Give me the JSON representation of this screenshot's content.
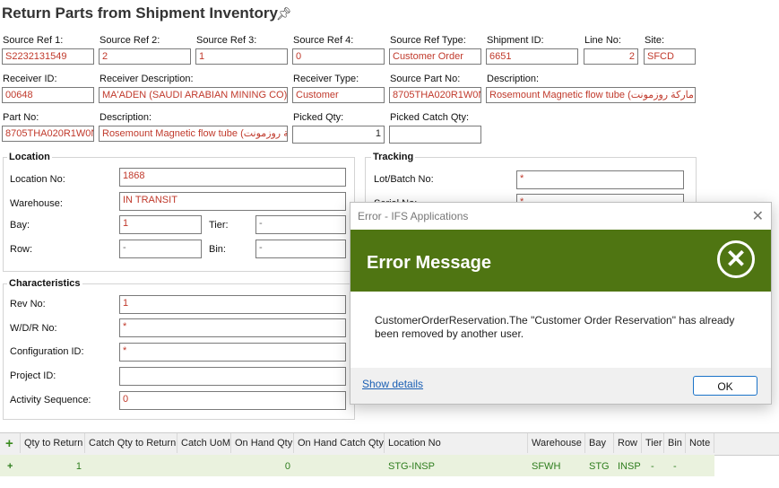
{
  "page": {
    "title": "Return Parts from Shipment Inventory"
  },
  "header_fields": {
    "source_ref1": {
      "label": "Source Ref 1:",
      "value": "S2232131549"
    },
    "source_ref2": {
      "label": "Source Ref 2:",
      "value": "2"
    },
    "source_ref3": {
      "label": "Source Ref 3:",
      "value": "1"
    },
    "source_ref4": {
      "label": "Source Ref 4:",
      "value": "0"
    },
    "source_ref_type": {
      "label": "Source Ref Type:",
      "value": "Customer Order"
    },
    "shipment_id": {
      "label": "Shipment ID:",
      "value": "6651"
    },
    "line_no": {
      "label": "Line No:",
      "value": "2"
    },
    "site": {
      "label": "Site:",
      "value": "SFCD"
    },
    "receiver_id": {
      "label": "Receiver ID:",
      "value": "00648"
    },
    "receiver_desc": {
      "label": "Receiver Description:",
      "value": "MA'ADEN (SAUDI ARABIAN MINING CO)"
    },
    "receiver_type": {
      "label": "Receiver Type:",
      "value": "Customer"
    },
    "source_part_no": {
      "label": "Source Part No:",
      "value": "8705THA020R1W0N"
    },
    "description1": {
      "label": "Description:",
      "value": "Rosemount Magnetic flow tube (ي ماركة روزمونت"
    },
    "part_no": {
      "label": "Part No:",
      "value": "8705THA020R1W0N"
    },
    "description2": {
      "label": "Description:",
      "value": "Rosemount Magnetic flow tube (كة روزمونت"
    },
    "picked_qty": {
      "label": "Picked Qty:",
      "value": "1"
    },
    "picked_catch_qty": {
      "label": "Picked Catch Qty:",
      "value": ""
    }
  },
  "location": {
    "title": "Location",
    "location_no": {
      "label": "Location No:",
      "value": "1868"
    },
    "warehouse": {
      "label": "Warehouse:",
      "value": "IN TRANSIT"
    },
    "bay": {
      "label": "Bay:",
      "value": "1"
    },
    "tier": {
      "label": "Tier:",
      "value": "-"
    },
    "row": {
      "label": "Row:",
      "value": "-"
    },
    "bin": {
      "label": "Bin:",
      "value": "-"
    }
  },
  "tracking": {
    "title": "Tracking",
    "lot_batch_no": {
      "label": "Lot/Batch No:",
      "value": "*"
    },
    "serial_no": {
      "label": "Serial No:",
      "value": "*"
    }
  },
  "characteristics": {
    "title": "Characteristics",
    "rev_no": {
      "label": "Rev No:",
      "value": "1"
    },
    "wdr_no": {
      "label": "W/D/R No:",
      "value": "*"
    },
    "configuration_id": {
      "label": "Configuration ID:",
      "value": "*"
    },
    "project_id": {
      "label": "Project ID:",
      "value": ""
    },
    "activity_sequence": {
      "label": "Activity Sequence:",
      "value": "0"
    }
  },
  "grid": {
    "columns": [
      "Qty to Return",
      "Catch Qty to Return",
      "Catch UoM",
      "On Hand Qty",
      "On Hand Catch Qty",
      "Location No",
      "Warehouse",
      "Bay",
      "Row",
      "Tier",
      "Bin",
      "Note"
    ],
    "row": {
      "qty_to_return": "1",
      "catch_qty": "",
      "catch_uom": "",
      "on_hand_qty": "0",
      "on_hand_catch_qty": "",
      "location_no": "STG-INSP",
      "warehouse": "SFWH",
      "bay": "STG",
      "row": "INSP",
      "tier": "-",
      "bin": "-",
      "note": ""
    }
  },
  "dialog": {
    "window_title": "Error - IFS Applications",
    "heading": "Error Message",
    "message": "CustomerOrderReservation.The \"Customer Order Reservation\" has already been removed by another user.",
    "details_link": "Show details",
    "ok_label": "OK",
    "accent_color": "#4f7512"
  },
  "icons": {
    "pin": "pin-icon",
    "add": "plus-icon",
    "close": "close-icon",
    "error": "error-x-icon"
  }
}
